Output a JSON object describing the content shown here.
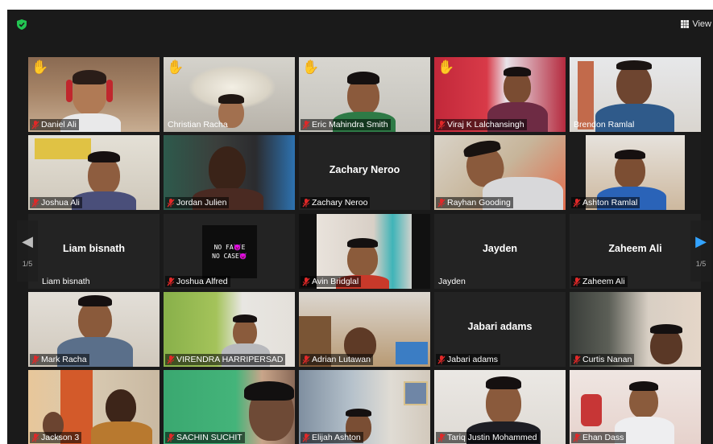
{
  "toolbar": {
    "view_label": "View",
    "shield_icon": "shield-check-icon",
    "view_icon": "grid-icon"
  },
  "pagination": {
    "left_page": "1/5",
    "right_page": "1/5"
  },
  "colors": {
    "active_speaker_border": "#d6d24a",
    "mute_red": "#e02828",
    "nav_arrow_active": "#33a3ff"
  },
  "tiles": [
    {
      "name": "Daniel Ali",
      "muted": true,
      "hand_raised": true,
      "video": true
    },
    {
      "name": "Christian Racha",
      "muted": false,
      "hand_raised": true,
      "video": true
    },
    {
      "name": "Eric Mahindra Smith",
      "muted": true,
      "hand_raised": true,
      "video": true
    },
    {
      "name": "Viraj K Lalchansingh",
      "muted": true,
      "hand_raised": true,
      "video": true
    },
    {
      "name": "Brendon Ramlal",
      "muted": false,
      "hand_raised": false,
      "video": true,
      "active_speaker": true
    },
    {
      "name": "Joshua Ali",
      "muted": true,
      "video": true
    },
    {
      "name": "Jordan Julien",
      "muted": true,
      "video": true
    },
    {
      "name": "Zachary Neroo",
      "muted": true,
      "video": false,
      "center_name": "Zachary Neroo"
    },
    {
      "name": "Rayhan Gooding",
      "muted": true,
      "video": true
    },
    {
      "name": "Ashton Ramlal",
      "muted": true,
      "video": true
    },
    {
      "name": "Liam bisnath",
      "muted": false,
      "video": false,
      "center_name": "Liam bisnath"
    },
    {
      "name": "Joshua Alfred",
      "muted": true,
      "video": false,
      "card_text": [
        "NO FA😈E",
        "NO CASE😈"
      ]
    },
    {
      "name": "Avin Bridglal",
      "muted": true,
      "video": true
    },
    {
      "name": "Jayden",
      "muted": false,
      "video": false,
      "center_name": "Jayden"
    },
    {
      "name": "Zaheem Ali",
      "muted": true,
      "video": false,
      "center_name": "Zaheem Ali"
    },
    {
      "name": "Mark Racha",
      "muted": true,
      "video": true
    },
    {
      "name": "VIRENDRA HARRIPERSAD",
      "muted": true,
      "video": true
    },
    {
      "name": "Adrian Lutawan",
      "muted": true,
      "video": true
    },
    {
      "name": "Jabari adams",
      "muted": true,
      "video": false,
      "center_name": "Jabari adams"
    },
    {
      "name": "Curtis Nanan",
      "muted": true,
      "video": true
    },
    {
      "name": "Jackson 3",
      "muted": true,
      "video": true
    },
    {
      "name": "SACHIN SUCHIT",
      "muted": true,
      "video": true
    },
    {
      "name": "Elijah Ashton",
      "muted": true,
      "video": true
    },
    {
      "name": "Tariq  Justin Mohammed",
      "muted": true,
      "video": true
    },
    {
      "name": "Ehan Dass",
      "muted": true,
      "video": true
    }
  ]
}
